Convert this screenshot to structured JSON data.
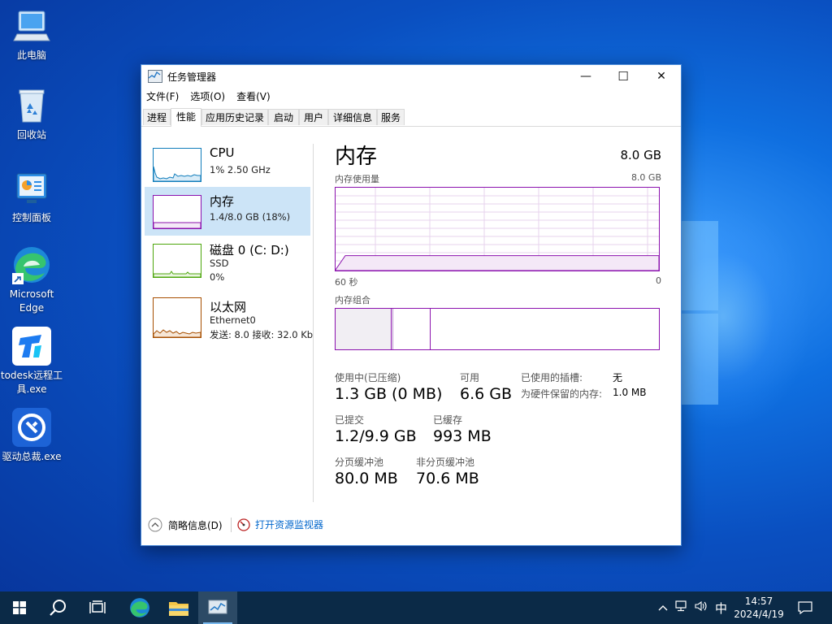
{
  "desktop": {
    "icons": [
      {
        "label": "此电脑",
        "icon": "this-pc-icon"
      },
      {
        "label": "回收站",
        "icon": "recycle-bin-icon"
      },
      {
        "label": "控制面板",
        "icon": "control-panel-icon"
      },
      {
        "label": "Microsoft Edge",
        "icon": "edge-icon"
      },
      {
        "label": "todesk远程工具.exe",
        "icon": "todesk-icon"
      },
      {
        "label": "驱动总裁.exe",
        "icon": "driver-tool-icon"
      }
    ]
  },
  "window": {
    "title": "任务管理器",
    "controls": {
      "minimize": "—",
      "maximize": "☐",
      "close": "✕"
    },
    "menu": [
      "文件(F)",
      "选项(O)",
      "查看(V)"
    ],
    "tabs": [
      "进程",
      "性能",
      "应用历史记录",
      "启动",
      "用户",
      "详细信息",
      "服务"
    ],
    "active_tab": "性能",
    "resources": [
      {
        "name": "CPU",
        "line1": "1% 2.50 GHz",
        "line2": "",
        "color": "#117dbb"
      },
      {
        "name": "内存",
        "line1": "1.4/8.0 GB (18%)",
        "line2": "",
        "color": "#8b12ae",
        "selected": true
      },
      {
        "name": "磁盘 0 (C: D:)",
        "line1": "SSD",
        "line2": "0%",
        "color": "#4da60c"
      },
      {
        "name": "以太网",
        "line1": "Ethernet0",
        "line2": "发送: 8.0 接收: 32.0 Kb",
        "color": "#a74f01"
      }
    ],
    "memory": {
      "title": "内存",
      "total": "8.0 GB",
      "usage_label": "内存使用量",
      "usage_max": "8.0 GB",
      "usage_percent": 18,
      "axis_left": "60 秒",
      "axis_right": "0",
      "composition_label": "内存组合",
      "stats": {
        "in_use_label": "使用中(已压缩)",
        "in_use_value": "1.3 GB (0 MB)",
        "available_label": "可用",
        "available_value": "6.6 GB",
        "slots_label": "已使用的插槽:",
        "slots_value": "无",
        "reserved_label": "为硬件保留的内存:",
        "reserved_value": "1.0 MB",
        "committed_label": "已提交",
        "committed_value": "1.2/9.9 GB",
        "cached_label": "已缓存",
        "cached_value": "993 MB",
        "paged_label": "分页缓冲池",
        "paged_value": "80.0 MB",
        "nonpaged_label": "非分页缓冲池",
        "nonpaged_value": "70.6 MB"
      }
    },
    "footer": {
      "fewer_details": "简略信息(D)",
      "open_monitor": "打开资源监视器"
    }
  },
  "taskbar": {
    "tray_ime": "中",
    "time": "14:57",
    "date": "2024/4/19"
  },
  "colors": {
    "memory_accent": "#8b12ae",
    "selection": "#cce4f7",
    "taskbar": "#0b2a47"
  }
}
